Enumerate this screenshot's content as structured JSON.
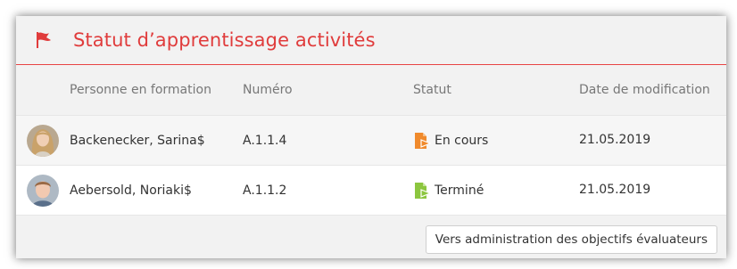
{
  "panel": {
    "title": "Statut d’apprentissage activités",
    "accent_color": "#e03c3c",
    "header_icon": "flag-icon"
  },
  "columns": {
    "person": "Personne en formation",
    "number": "Numéro",
    "status": "Statut",
    "date": "Date de modification"
  },
  "rows": [
    {
      "name": "Backenecker, Sarina$",
      "number": "A.1.1.4",
      "status": "En cours",
      "status_icon": "in-progress-document-icon",
      "status_color": "#f08a2c",
      "date": "21.05.2019"
    },
    {
      "name": "Aebersold, Noriaki$",
      "number": "A.1.1.2",
      "status": "Terminé",
      "status_icon": "completed-document-icon",
      "status_color": "#8cc63f",
      "date": "21.05.2019"
    }
  ],
  "footer": {
    "button_label": "Vers administration des objectifs évaluateurs"
  }
}
